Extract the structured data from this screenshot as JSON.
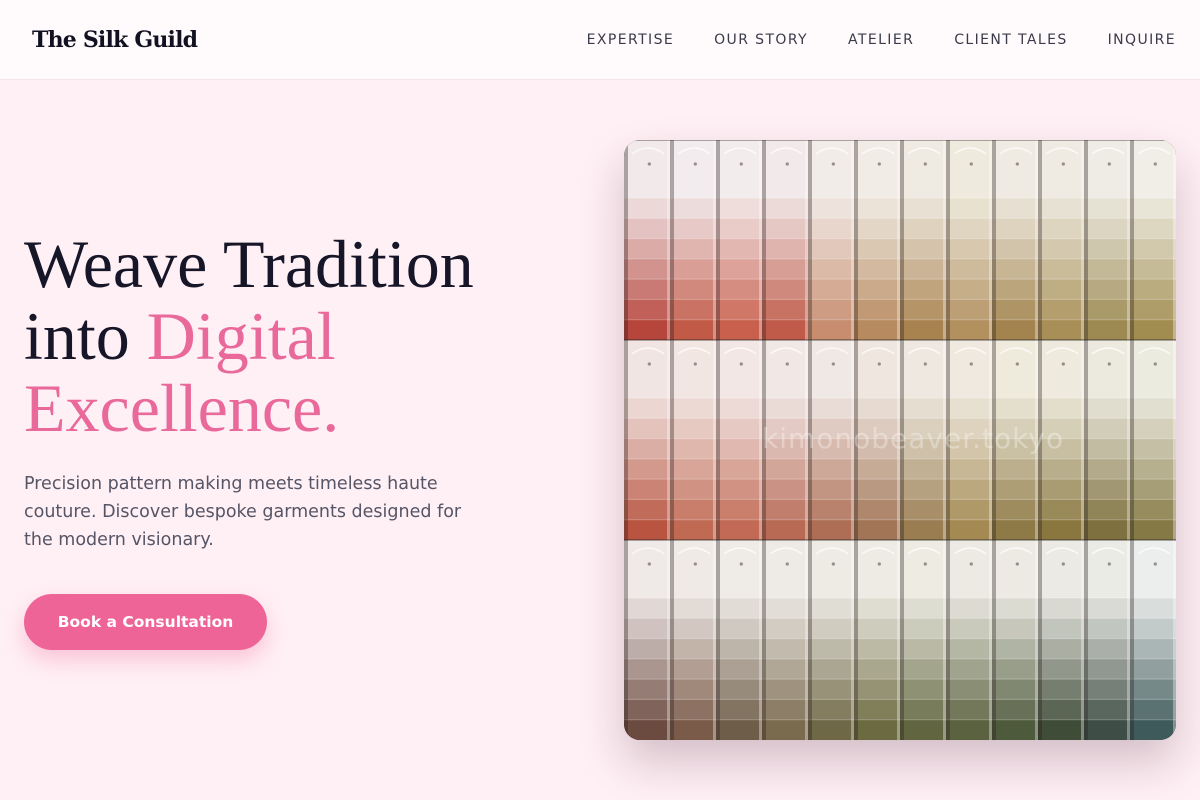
{
  "header": {
    "logo": "The Silk Guild",
    "nav": [
      {
        "label": "EXPERTISE"
      },
      {
        "label": "OUR STORY"
      },
      {
        "label": "ATELIER"
      },
      {
        "label": "CLIENT TALES"
      },
      {
        "label": "INQUIRE"
      }
    ]
  },
  "hero": {
    "title_line1": "Weave Tradition",
    "title_line2_prefix": "into ",
    "title_line2_accent": "Digital",
    "title_line3_accent": "Excellence.",
    "subtitle": "Precision pattern making meets timeless haute couture. Discover bespoke garments designed for the modern visionary.",
    "cta_label": "Book a Consultation"
  },
  "image": {
    "watermark": "kimonobeaver.tokyo"
  },
  "colors": {
    "accent": "#ef6496",
    "background": "#fff0f5"
  }
}
